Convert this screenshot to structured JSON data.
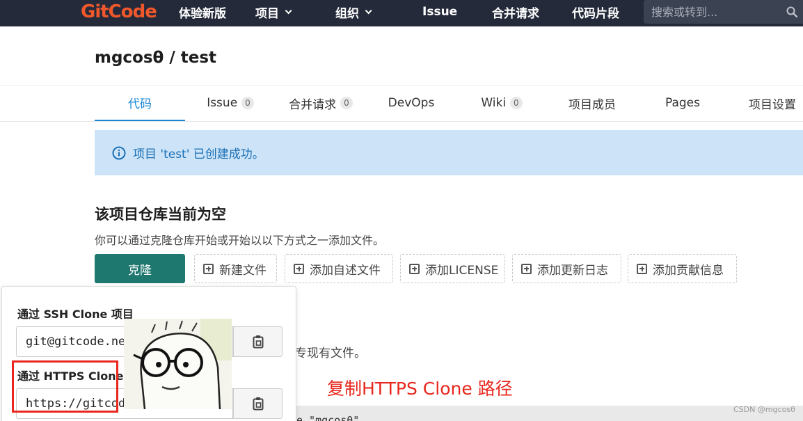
{
  "nav": {
    "logo": "GitCode",
    "items": [
      "体验新版",
      "项目",
      "组织",
      "Issue",
      "合并请求",
      "代码片段"
    ],
    "search_placeholder": "搜索或转到..."
  },
  "project": {
    "title": "mgcosθ / test"
  },
  "tabs": [
    {
      "label": "代码",
      "active": true
    },
    {
      "label": "Issue",
      "count": "0"
    },
    {
      "label": "合并请求",
      "count": "0"
    },
    {
      "label": "DevOps"
    },
    {
      "label": "Wiki",
      "count": "0"
    },
    {
      "label": "项目成员"
    },
    {
      "label": "Pages"
    },
    {
      "label": "项目设置"
    }
  ],
  "alert": {
    "text": "项目 'test' 已创建成功。",
    "color": "#cde4f8"
  },
  "empty": {
    "title": "该项目仓库当前为空",
    "description": "你可以通过克隆仓库开始或开始以以下方式之一添加文件。"
  },
  "actions": {
    "clone": "克隆",
    "buttons": [
      "新建文件",
      "添加自述文件",
      "添加LICENSE",
      "添加更新日志",
      "添加贡献信息"
    ]
  },
  "background": {
    "partial_text": "专现有文件。",
    "code_partial": "e \"mgcosθ\""
  },
  "dropdown": {
    "ssh_label": "通过 SSH Clone 项目",
    "ssh_value": "git@gitcode.net",
    "https_label": "通过 HTTPS Clone 项目",
    "https_value": "https://gitcode"
  },
  "annotation": {
    "text": "复制HTTPS Clone 路径",
    "color": "#e8281e"
  },
  "watermark": "CSDN @mgcosθ",
  "colors": {
    "nav_bg": "#242a3a",
    "brand": "#f0582b",
    "primary": "#1e7870",
    "link": "#1a87d6"
  }
}
